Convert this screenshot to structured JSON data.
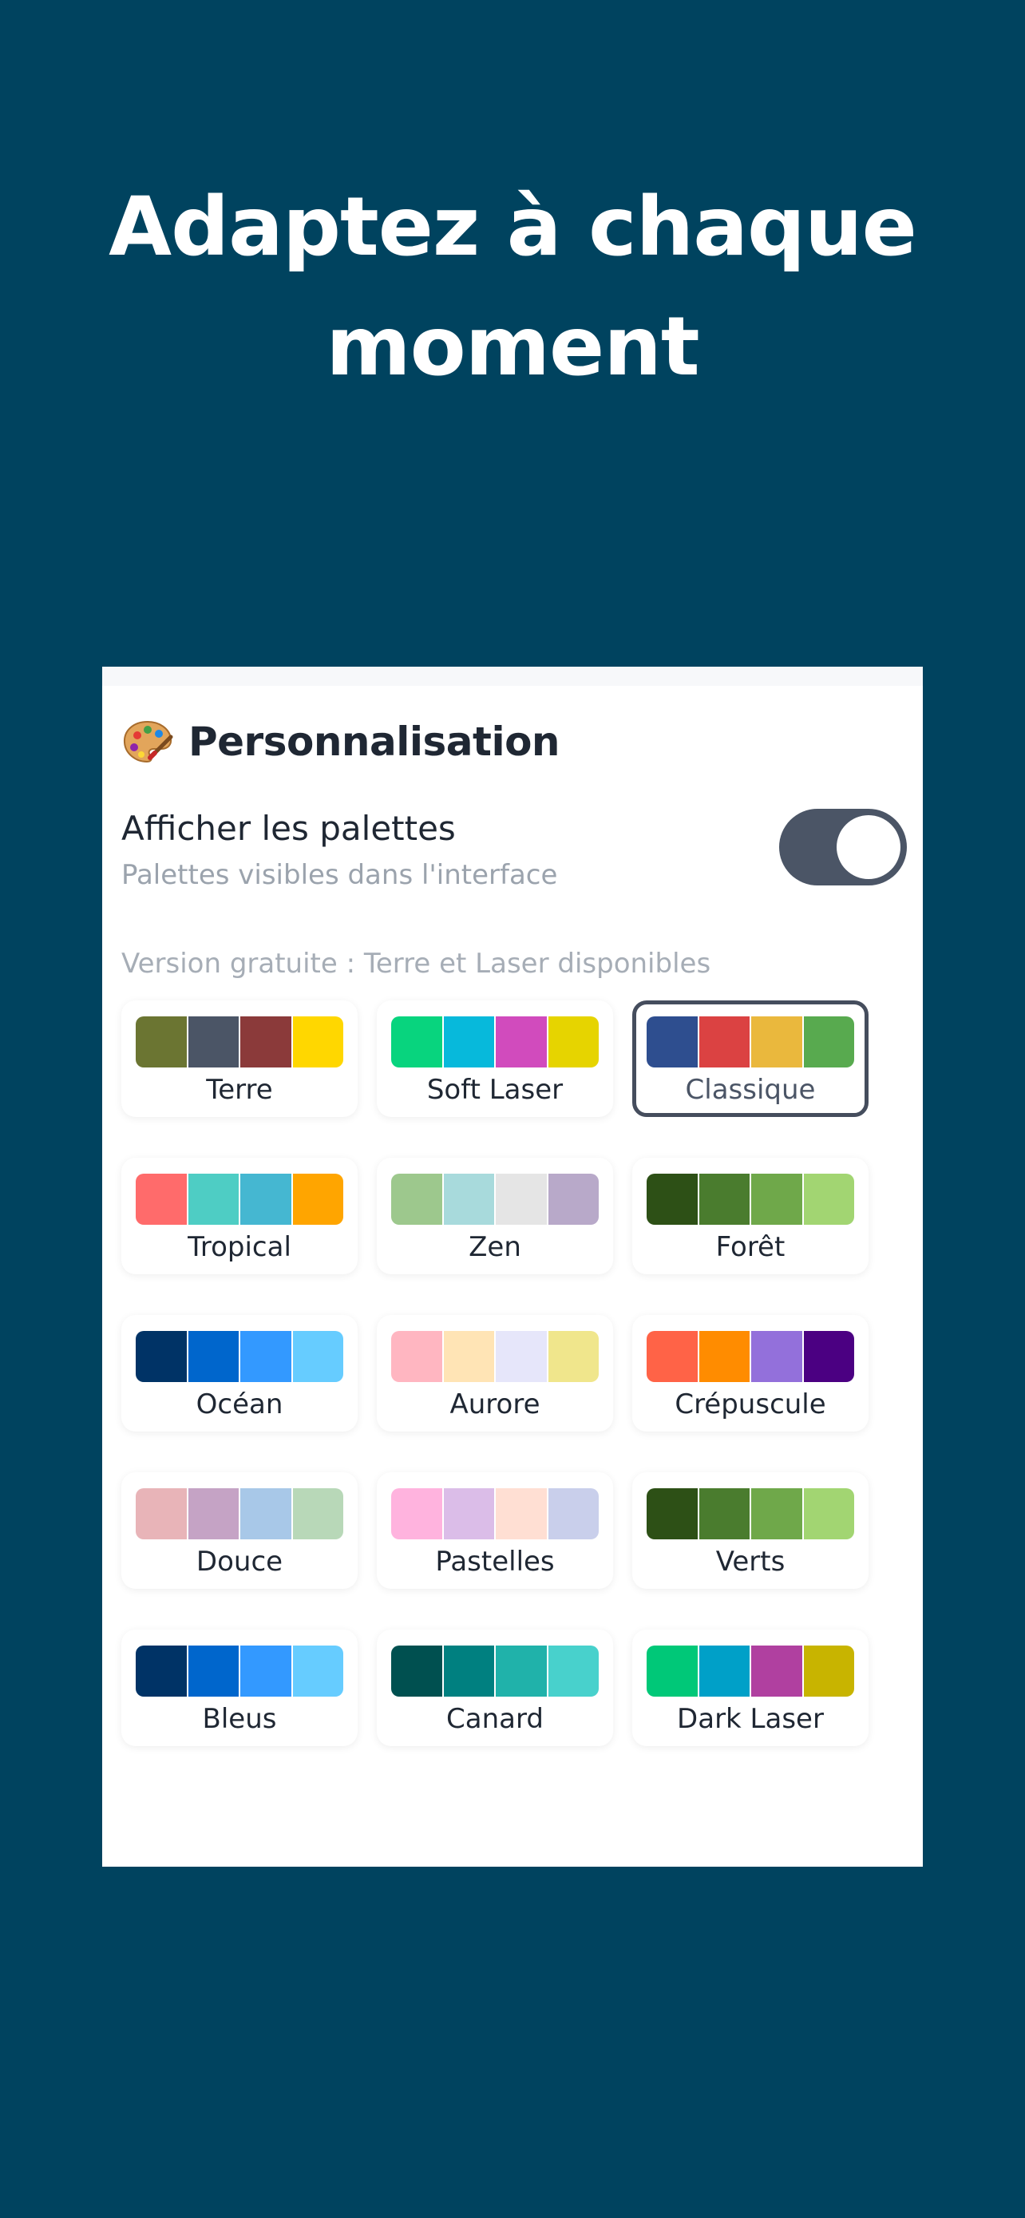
{
  "headline": {
    "line1": "Adaptez à chaque",
    "line2": "moment"
  },
  "settings": {
    "section_title": "Personnalisation",
    "section_icon": "artist-palette-icon",
    "show_palettes_label": "Afficher les palettes",
    "show_palettes_desc": "Palettes visibles dans l'interface",
    "show_palettes_enabled": true,
    "free_version_note": "Version gratuite : Terre et Laser disponibles"
  },
  "colors": {
    "background": "#00435f",
    "toggle_on": "#4b5566",
    "selected_border": "#454d5d"
  },
  "palettes": [
    {
      "name": "Terre",
      "selected": false,
      "colors": [
        "#6b7532",
        "#4b5566",
        "#8b3a3a",
        "#ffd700"
      ]
    },
    {
      "name": "Soft Laser",
      "selected": false,
      "colors": [
        "#08d47e",
        "#07b9db",
        "#d14bbd",
        "#e6d400"
      ]
    },
    {
      "name": "Classique",
      "selected": true,
      "colors": [
        "#2e4e8f",
        "#db4242",
        "#eab83d",
        "#58aa4f"
      ]
    },
    {
      "name": "Tropical",
      "selected": false,
      "colors": [
        "#ff6b6b",
        "#4ecdc4",
        "#45b7d1",
        "#ffa500"
      ]
    },
    {
      "name": "Zen",
      "selected": false,
      "colors": [
        "#9dc88d",
        "#a8dadc",
        "#e5e5e5",
        "#b8a9c9"
      ]
    },
    {
      "name": "Forêt",
      "selected": false,
      "colors": [
        "#2d5016",
        "#4a7c2e",
        "#6fa84a",
        "#a2d572"
      ]
    },
    {
      "name": "Océan",
      "selected": false,
      "colors": [
        "#003366",
        "#0066cc",
        "#3399ff",
        "#66ccff"
      ]
    },
    {
      "name": "Aurore",
      "selected": false,
      "colors": [
        "#ffb6c1",
        "#ffe4b5",
        "#e6e6fa",
        "#f0e68c"
      ]
    },
    {
      "name": "Crépuscule",
      "selected": false,
      "colors": [
        "#ff6347",
        "#ff8c00",
        "#9370db",
        "#4b0082"
      ]
    },
    {
      "name": "Douce",
      "selected": false,
      "colors": [
        "#e8b4b8",
        "#c5a3c5",
        "#a8c8e8",
        "#b8d8b8"
      ]
    },
    {
      "name": "Pastelles",
      "selected": false,
      "colors": [
        "#ffb3de",
        "#dbbde8",
        "#ffdfd3",
        "#c9cfeb"
      ]
    },
    {
      "name": "Verts",
      "selected": false,
      "colors": [
        "#2d5016",
        "#4a7c2e",
        "#6fa84a",
        "#a2d572"
      ]
    },
    {
      "name": "Bleus",
      "selected": false,
      "colors": [
        "#003366",
        "#0066cc",
        "#3399ff",
        "#66ccff"
      ]
    },
    {
      "name": "Canard",
      "selected": false,
      "colors": [
        "#005050",
        "#008080",
        "#20b2aa",
        "#48d1cc"
      ]
    },
    {
      "name": "Dark Laser",
      "selected": false,
      "colors": [
        "#00c878",
        "#00a0c8",
        "#b040a0",
        "#c8b400"
      ]
    }
  ]
}
